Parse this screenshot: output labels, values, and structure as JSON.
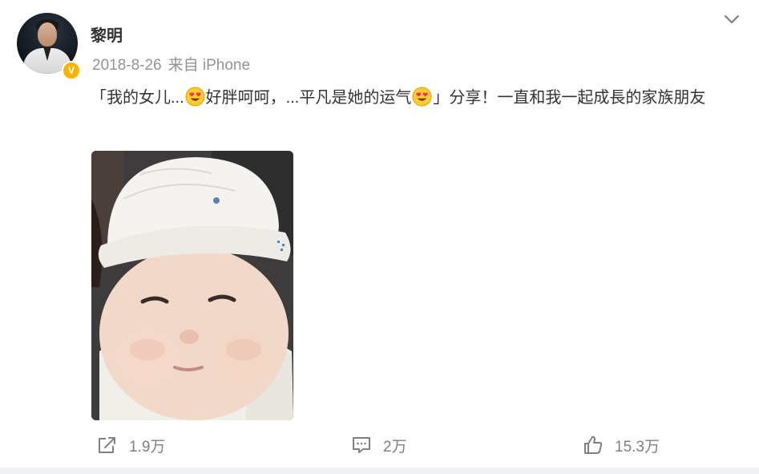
{
  "post": {
    "author": {
      "name": "黎明",
      "verified_badge": "V",
      "verified_color": "#f7b500"
    },
    "date": "2018-8-26",
    "source": "来自 iPhone",
    "text": {
      "part1": "「我的女儿...",
      "part2": "好胖呵呵，...平凡是她的运气",
      "part3": "」分享！一直和我一起成長的家族朋友"
    },
    "emoji_icon": "heart-eyes-emoji",
    "image_icon": "baby-photo",
    "actions": {
      "share_count": "1.9万",
      "comment_count": "2万",
      "like_count": "15.3万"
    }
  },
  "colors": {
    "text": "#333333",
    "meta": "#939393",
    "action": "#808080",
    "page_bottom": "#f0f1f5"
  }
}
